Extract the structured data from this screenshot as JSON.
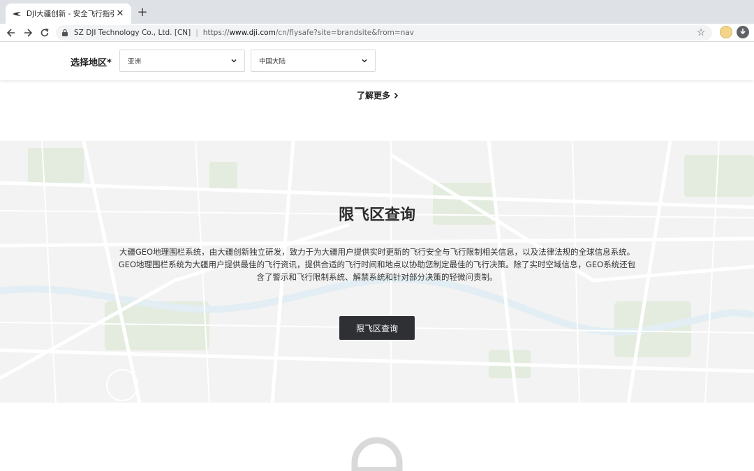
{
  "browser": {
    "tab": {
      "title": "DJI大疆创新 - 安全飞行指引",
      "favicon": "dji-logo-icon"
    },
    "address": {
      "org": "SZ DJI Technology Co., Ltd. [CN]",
      "scheme": "https://",
      "host": "www.dji.com",
      "path": "/cn/flysafe?site=brandsite&from=nav"
    }
  },
  "region": {
    "label": "选择地区*",
    "continent": "亚洲",
    "country": "中国大陆"
  },
  "learn_more": "了解更多",
  "geo": {
    "title": "限飞区查询",
    "description": "大疆GEO地理围栏系统，由大疆创新独立研发，致力于为大疆用户提供实时更新的飞行安全与飞行限制相关信息，以及法律法规的全球信息系统。GEO地理围栏系统为大疆用户提供最佳的飞行资讯，提供合适的飞行时间和地点以协助您制定最佳的飞行决策。除了实时空域信息，GEO系统还包含了警示和飞行限制系统、解禁系统和针对部分决策的轻微问责制。",
    "button": "限飞区查询"
  },
  "colors": {
    "button_bg": "#2f3033",
    "map_bg": "#f3f3f3",
    "map_park": "#e3ecde",
    "map_road": "#ffffff",
    "map_river": "#e2eef3"
  }
}
